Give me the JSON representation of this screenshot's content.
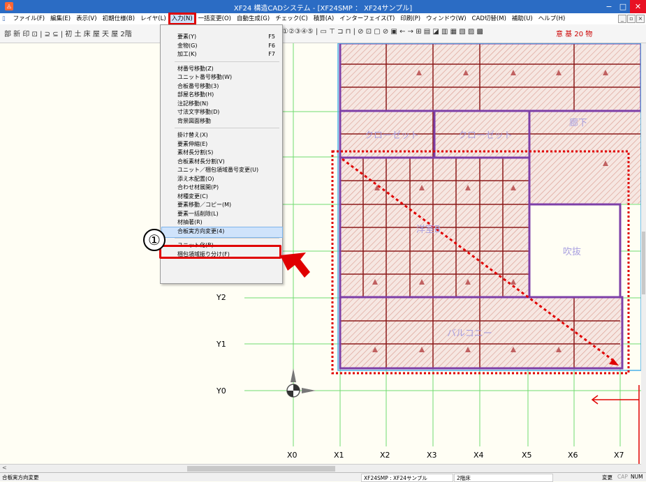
{
  "window": {
    "title": "XF24 構造CADシステム - [XF24SMP ： XF24サンプル]",
    "icon_glyph": "◬",
    "minimize": "−",
    "maximize": "□",
    "close": "✕"
  },
  "menubar": [
    "ファイル(F)",
    "編集(E)",
    "表示(V)",
    "初期仕様(B)",
    "レイヤ(L)",
    "入力(N)",
    "一括変更(O)",
    "自動生成(G)",
    "チェック(C)",
    "積算(A)",
    "インターフェイス(T)",
    "印刷(P)",
    "ウィンドウ(W)",
    "CAD切替(M)",
    "補助(U)",
    "ヘルプ(H)"
  ],
  "active_menu": "入力(N)",
  "toolbar": {
    "left_text": "部 新 印 ⊡ | ⊇ ⊆ | 初 土 床 屋 天 屋 2階",
    "mid_text": "①②③④⑤ | ▭ ⊤ ⊐ ⊓ | ⊘ ⊡ ▢ ⊘ ▣ ← → ⊞ ▤ ◪ ▥ ▦ ▧ ▨ ▩",
    "right_text": "意 基 20 物"
  },
  "mdi_buttons": [
    "_",
    "▫",
    "×"
  ],
  "dropdown": {
    "groups": [
      [
        {
          "label": "要素(Y)",
          "shortcut": "F5"
        },
        {
          "label": "金物(G)",
          "shortcut": "F6"
        },
        {
          "label": "加工(K)",
          "shortcut": "F7"
        }
      ],
      [
        {
          "label": "材番号移動(Z)",
          "shortcut": ""
        },
        {
          "label": "ユニット番号移動(W)",
          "shortcut": ""
        },
        {
          "label": "合板番号移動(3)",
          "shortcut": ""
        },
        {
          "label": "部屋名移動(H)",
          "shortcut": ""
        },
        {
          "label": "注記移動(N)",
          "shortcut": ""
        },
        {
          "label": "寸法文字移動(D)",
          "shortcut": ""
        },
        {
          "label": "背景図面移動",
          "shortcut": ""
        }
      ],
      [
        {
          "label": "掛け替え(X)",
          "shortcut": ""
        },
        {
          "label": "要素伸縮(E)",
          "shortcut": ""
        },
        {
          "label": "素材長分割(S)",
          "shortcut": ""
        },
        {
          "label": "合板素材長分割(V)",
          "shortcut": ""
        },
        {
          "label": "ユニット／梱包領域番号変更(U)",
          "shortcut": ""
        },
        {
          "label": "添え木配置(O)",
          "shortcut": ""
        },
        {
          "label": "合わせ材展開(P)",
          "shortcut": ""
        },
        {
          "label": "材種変更(C)",
          "shortcut": ""
        },
        {
          "label": "要素移動／コピー(M)",
          "shortcut": ""
        },
        {
          "label": "要素一括削除(L)",
          "shortcut": ""
        },
        {
          "label": "材抽著(R)",
          "shortcut": ""
        },
        {
          "label": "合板実方向変更(4)",
          "shortcut": ""
        }
      ],
      [
        {
          "label": "ユニット化(B)...",
          "shortcut": ""
        },
        {
          "label": "梱包領域振り分け(F)",
          "shortcut": ""
        }
      ]
    ],
    "highlighted": "合板実方向変更(4)"
  },
  "callout": {
    "marker": "①"
  },
  "rooms": [
    {
      "name": "クローゼット"
    },
    {
      "name": "クローゼット"
    },
    {
      "name": "廊下"
    },
    {
      "name": "洋室B"
    },
    {
      "name": "吹抜"
    },
    {
      "name": "バルコニー"
    }
  ],
  "grid": {
    "x_labels": [
      "X0",
      "X1",
      "X2",
      "X3",
      "X4",
      "X5",
      "X6",
      "X7"
    ],
    "y_labels": [
      "Y2",
      "Y1",
      "Y0"
    ]
  },
  "status": {
    "left": "合板実方向変更",
    "file": "XF24SMP : XF24サンプル",
    "floor": "2階床",
    "mode": "変更",
    "caps": "CAP",
    "num": "NUM"
  },
  "colors": {
    "titlebar": "#2b6cc4",
    "canvas_bg": "#fffef4",
    "grid_line": "#6fdc6f",
    "hatch": "#d99a8e",
    "wall": "#7d3fa8",
    "beam": "#8b1a1a",
    "highlight_red": "#e00000",
    "room_label": "#a9a0e0"
  }
}
